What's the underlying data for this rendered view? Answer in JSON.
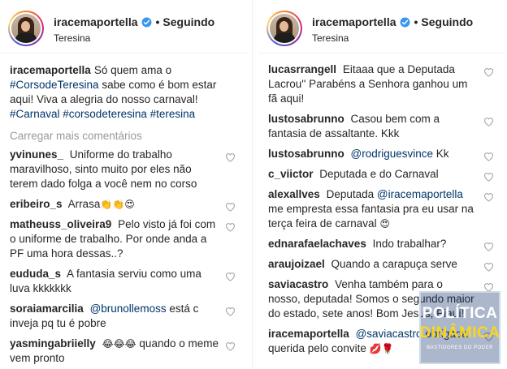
{
  "profile": {
    "username": "iracemaportella",
    "separator": "•",
    "follow_status": "Seguindo",
    "location": "Teresina"
  },
  "left": {
    "caption": {
      "author": "iracemaportella",
      "text_1": "Só quem ama o",
      "hashtag_1": "#CorsodeTeresina",
      "text_2": "sabe como é bom estar aqui! Viva a alegria do nosso carnaval!",
      "hashtags": "#Carnaval #corsodeteresina #teresina"
    },
    "load_more": "Carregar mais comentários",
    "comments": [
      {
        "author": "yvinunes_",
        "text": "Uniforme do trabalho maravilhoso, sinto muito por eles não terem dado folga a você nem no corso"
      },
      {
        "author": "eribeiro_s",
        "text": "Arrasa",
        "emoji": "👏👏😍"
      },
      {
        "author": "matheuss_oliveira9",
        "text": "Pelo visto já foi com o uniforme de trabalho. Por onde anda a PF uma hora dessas..?"
      },
      {
        "author": "eududa_s",
        "text": "A fantasia serviu como uma luva kkkkkkk"
      },
      {
        "author": "soraiamarcilia",
        "mention": "@brunollemoss",
        "text": "está c inveja pq tu é pobre"
      },
      {
        "author": "yasmingabriielly",
        "emoji": "😂😂😂",
        "text": "quando o meme vem pronto"
      }
    ]
  },
  "right": {
    "comments": [
      {
        "author": "lucasrrangell",
        "text": "Eitaaa que a Deputada Lacrou'' Parabéns a Senhora ganhou um fã aqui!"
      },
      {
        "author": "lustosabrunno",
        "text": "Casou bem com a fantasia de assaltante. Kkk"
      },
      {
        "author": "lustosabrunno",
        "mention": "@rodriguesvince",
        "text": "Kk"
      },
      {
        "author": "c_viictor",
        "text": "Deputada e do Carnaval"
      },
      {
        "author": "alexallves",
        "text": "Deputada",
        "mention": "@iracemaportella",
        "text_2": "me empresta essa fantasia pra eu usar na terça feira de carnaval",
        "emoji": "😍"
      },
      {
        "author": "ednarafaelachaves",
        "text": "Indo trabalhar?"
      },
      {
        "author": "araujoizael",
        "text": "Quando a carapuça serve"
      },
      {
        "author": "saviacastro",
        "text": "Venha também para o nosso, deputada! Somos o segundo maior do estado, sete anos! Bom Jesus, Piauí!"
      },
      {
        "author": "iracemaportella",
        "mention": "@saviacastro",
        "text": "obrigada querida pelo convite",
        "emoji": "💋🌹"
      }
    ]
  },
  "watermark": {
    "line_1": "POLÍTICA",
    "line_2": "DINÂMICA",
    "line_3": "BASTIDORES DO PODER"
  },
  "colors": {
    "text": "#262626",
    "link": "#003569",
    "muted": "#999999",
    "verified": "#3897f0"
  }
}
